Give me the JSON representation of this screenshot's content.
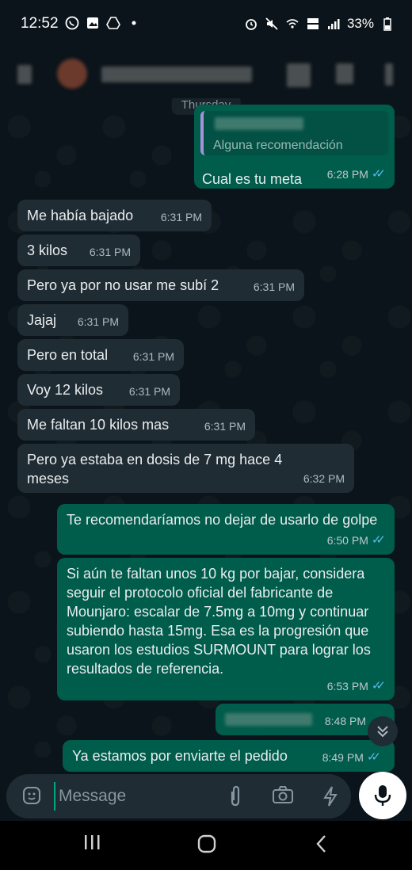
{
  "status_bar": {
    "time": "12:52",
    "battery": "33%",
    "left_icons": [
      "whatsapp-icon",
      "gallery-icon",
      "drive-icon",
      "dot-icon"
    ],
    "right_icons": [
      "alarm-icon",
      "mute-icon",
      "wifi-calling-icon",
      "volte-icon",
      "signal-icon",
      "battery-icon"
    ]
  },
  "chat": {
    "date_label": "Thursday",
    "messages": [
      {
        "dir": "out",
        "quote": "Alguna recomendación",
        "text": "Cual es tu meta",
        "time": "6:28 PM"
      },
      {
        "dir": "in",
        "text": "Me había bajado",
        "time": "6:31 PM"
      },
      {
        "dir": "in",
        "text": "3 kilos",
        "time": "6:31 PM"
      },
      {
        "dir": "in",
        "text": "Pero ya por no usar me subí 2",
        "time": "6:31 PM"
      },
      {
        "dir": "in",
        "text": "Jajaj",
        "time": "6:31 PM"
      },
      {
        "dir": "in",
        "text": "Pero en total",
        "time": "6:31 PM"
      },
      {
        "dir": "in",
        "text": "Voy 12 kilos",
        "time": "6:31 PM"
      },
      {
        "dir": "in",
        "text": "Me faltan 10 kilos mas",
        "time": "6:31 PM"
      },
      {
        "dir": "in",
        "text": "Pero ya estaba en dosis de 7 mg hace 4 meses",
        "time": "6:32 PM"
      },
      {
        "dir": "out",
        "text": "Te recomendaríamos no dejar de usarlo de golpe",
        "time": "6:50 PM"
      },
      {
        "dir": "out",
        "text": "Si aún te faltan unos 10 kg por bajar, considera seguir el protocolo oficial del fabricante de Mounjaro: escalar de 7.5mg a 10mg y continuar subiendo hasta 15mg. Esa es la progresión que usaron los estudios SURMOUNT para lograr los resultados de referencia.",
        "time": "6:53 PM"
      },
      {
        "dir": "out",
        "text": "",
        "time": "8:48 PM"
      },
      {
        "dir": "out",
        "text": "Ya estamos por enviarte el pedido",
        "time": "8:49 PM"
      }
    ]
  },
  "input": {
    "placeholder": "Message"
  },
  "colors": {
    "background": "#0b141a",
    "incoming_bubble": "#202c33",
    "outgoing_bubble": "#005c4b",
    "read_ticks": "#53bdeb"
  }
}
